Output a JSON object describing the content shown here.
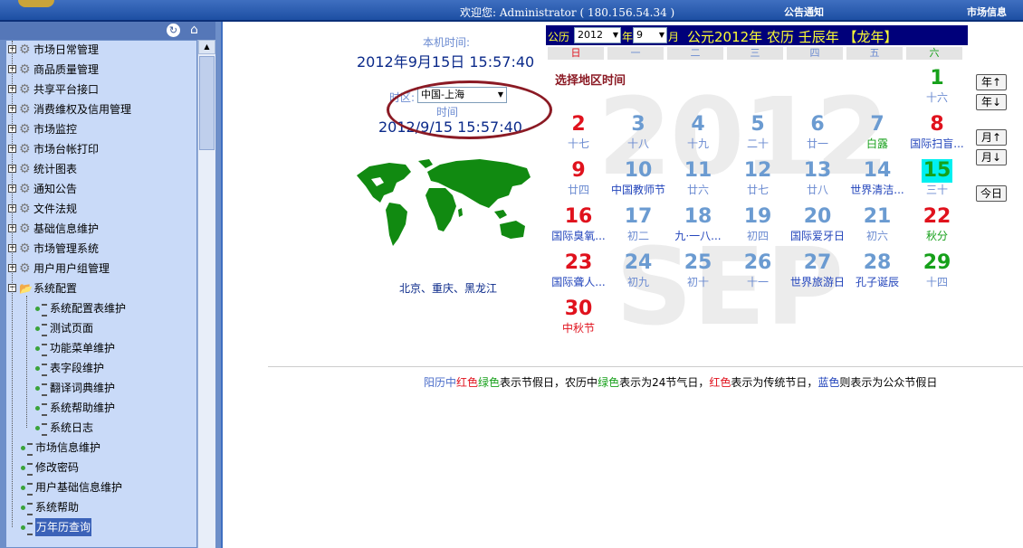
{
  "topbar": {
    "welcome": "欢迎您: Administrator ( 180.156.54.34 )",
    "notice": "公告通知",
    "market": "市场信息"
  },
  "sidebar": {
    "items": [
      {
        "label": "市场日常管理"
      },
      {
        "label": "商品质量管理"
      },
      {
        "label": "共享平台接口"
      },
      {
        "label": "消费维权及信用管理"
      },
      {
        "label": "市场监控"
      },
      {
        "label": "市场台帐打印"
      },
      {
        "label": "统计图表"
      },
      {
        "label": "通知公告"
      },
      {
        "label": "文件法规"
      },
      {
        "label": "基础信息维护"
      },
      {
        "label": "市场管理系统"
      },
      {
        "label": "用户用户组管理"
      },
      {
        "label": "系统配置"
      }
    ],
    "subitems": [
      {
        "label": "系统配置表维护"
      },
      {
        "label": "测试页面"
      },
      {
        "label": "功能菜单维护"
      },
      {
        "label": "表字段维护"
      },
      {
        "label": "翻译词典维护"
      },
      {
        "label": "系统帮助维护"
      },
      {
        "label": "系统日志"
      }
    ],
    "leaves": [
      {
        "label": "市场信息维护"
      },
      {
        "label": "修改密码"
      },
      {
        "label": "用户基础信息维护"
      },
      {
        "label": "系统帮助"
      },
      {
        "label": "万年历查询"
      }
    ]
  },
  "clock": {
    "local_label": "本机时间:",
    "local_time": "2012年9月15日  15:57:40",
    "zone_label": "时区:",
    "zone_value": "中国-上海",
    "time_label": "时间",
    "zone_time": "2012/9/15 15:57:40",
    "cities": "北京、重庆、黑龙江"
  },
  "calendar": {
    "label_gongli": "公历",
    "year_value": "2012",
    "label_year": "年",
    "month_value": "9",
    "label_month": "月",
    "title": "公元2012年  农历 壬辰年  【龙年】",
    "weekdays": [
      "日",
      "一",
      "二",
      "三",
      "四",
      "五",
      "六"
    ],
    "select_region": "选择地区时间",
    "bg_year": "2012",
    "bg_month": "SEP",
    "days": [
      {
        "num": "1",
        "sub": "十六",
        "color": "#16a01a",
        "subcolor": "#6b8bd1"
      },
      {
        "num": "2",
        "sub": "十七",
        "color": "#e0121d",
        "subcolor": "#6b8bd1"
      },
      {
        "num": "3",
        "sub": "十八",
        "color": "#6b9bd1",
        "subcolor": "#6b8bd1"
      },
      {
        "num": "4",
        "sub": "十九",
        "color": "#6b9bd1",
        "subcolor": "#6b8bd1"
      },
      {
        "num": "5",
        "sub": "二十",
        "color": "#6b9bd1",
        "subcolor": "#6b8bd1"
      },
      {
        "num": "6",
        "sub": "廿一",
        "color": "#6b9bd1",
        "subcolor": "#6b8bd1"
      },
      {
        "num": "7",
        "sub": "白露",
        "color": "#6b9bd1",
        "subcolor": "#16a01a"
      },
      {
        "num": "8",
        "sub": "国际扫盲...",
        "color": "#e0121d",
        "subcolor": "#2244bb"
      },
      {
        "num": "9",
        "sub": "廿四",
        "color": "#e0121d",
        "subcolor": "#6b8bd1"
      },
      {
        "num": "10",
        "sub": "中国教师节",
        "color": "#6b9bd1",
        "subcolor": "#2244bb"
      },
      {
        "num": "11",
        "sub": "廿六",
        "color": "#6b9bd1",
        "subcolor": "#6b8bd1"
      },
      {
        "num": "12",
        "sub": "廿七",
        "color": "#6b9bd1",
        "subcolor": "#6b8bd1"
      },
      {
        "num": "13",
        "sub": "廿八",
        "color": "#6b9bd1",
        "subcolor": "#6b8bd1"
      },
      {
        "num": "14",
        "sub": "世界清洁...",
        "color": "#6b9bd1",
        "subcolor": "#2244bb"
      },
      {
        "num": "15",
        "sub": "三十",
        "color": "#16a01a",
        "subcolor": "#6b8bd1",
        "today": true
      },
      {
        "num": "16",
        "sub": "国际臭氧...",
        "color": "#e0121d",
        "subcolor": "#2244bb"
      },
      {
        "num": "17",
        "sub": "初二",
        "color": "#6b9bd1",
        "subcolor": "#6b8bd1"
      },
      {
        "num": "18",
        "sub": "九·一八...",
        "color": "#6b9bd1",
        "subcolor": "#2244bb"
      },
      {
        "num": "19",
        "sub": "初四",
        "color": "#6b9bd1",
        "subcolor": "#6b8bd1"
      },
      {
        "num": "20",
        "sub": "国际爱牙日",
        "color": "#6b9bd1",
        "subcolor": "#2244bb"
      },
      {
        "num": "21",
        "sub": "初六",
        "color": "#6b9bd1",
        "subcolor": "#6b8bd1"
      },
      {
        "num": "22",
        "sub": "秋分",
        "color": "#e0121d",
        "subcolor": "#16a01a"
      },
      {
        "num": "23",
        "sub": "国际聋人...",
        "color": "#e0121d",
        "subcolor": "#2244bb"
      },
      {
        "num": "24",
        "sub": "初九",
        "color": "#6b9bd1",
        "subcolor": "#6b8bd1"
      },
      {
        "num": "25",
        "sub": "初十",
        "color": "#6b9bd1",
        "subcolor": "#6b8bd1"
      },
      {
        "num": "26",
        "sub": "十一",
        "color": "#6b9bd1",
        "subcolor": "#6b8bd1"
      },
      {
        "num": "27",
        "sub": "世界旅游日",
        "color": "#6b9bd1",
        "subcolor": "#2244bb"
      },
      {
        "num": "28",
        "sub": "孔子诞辰",
        "color": "#6b9bd1",
        "subcolor": "#2244bb"
      },
      {
        "num": "29",
        "sub": "十四",
        "color": "#16a01a",
        "subcolor": "#6b8bd1"
      },
      {
        "num": "30",
        "sub": "中秋节",
        "color": "#e0121d",
        "subcolor": "#e0121d"
      }
    ],
    "buttons": {
      "year_up": "年↑",
      "year_down": "年↓",
      "month_up": "月↑",
      "month_down": "月↓",
      "today": "今日"
    }
  },
  "legend": {
    "p1": "阳历中",
    "p2": "红色",
    "p3": "绿色",
    "p4": "表示节假日，农历中",
    "p5": "绿色",
    "p6": "表示为24节气日，",
    "p7": "红色",
    "p8": "表示为传统节日，",
    "p9": "蓝色",
    "p10": "则表示为公众节假日"
  }
}
